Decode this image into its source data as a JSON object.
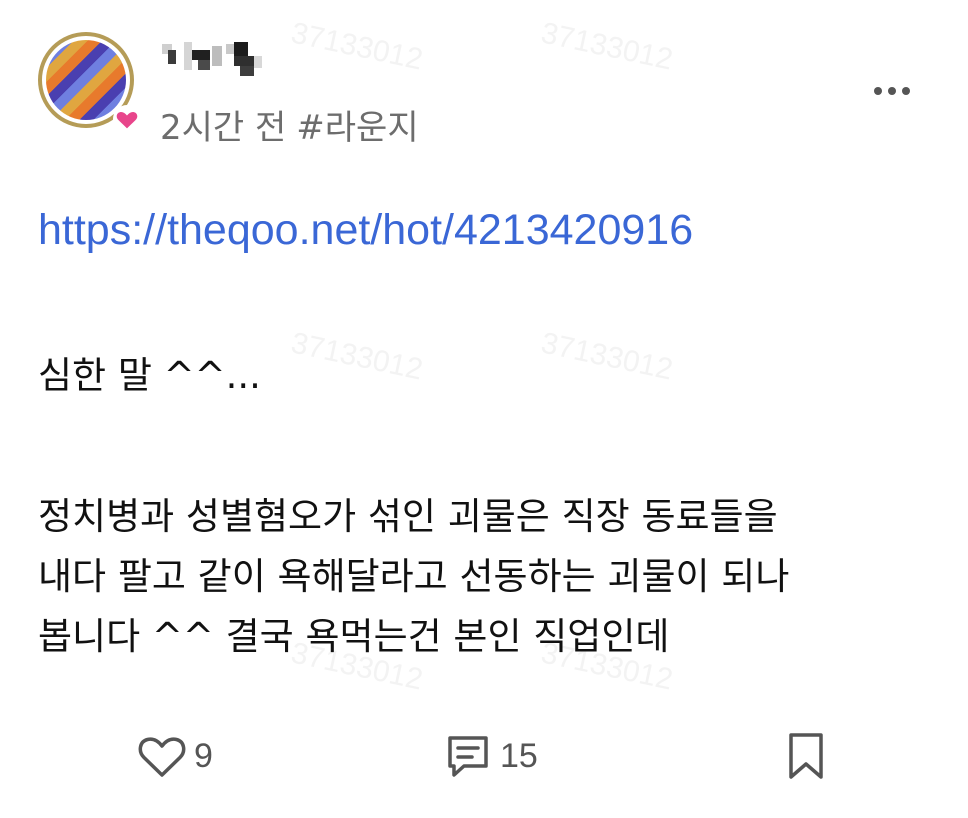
{
  "watermark": "37133012",
  "post": {
    "time": "2시간 전",
    "tag": "#라운지",
    "link": "https://theqoo.net/hot/4213420916",
    "paragraph1": "심한 말 ^^...",
    "paragraph2": "정치병과 성별혐오가 섞인 괴물은 직장 동료들을\n내다 팔고 같이 욕해달라고 선동하는 괴물이 되나\n봅니다 ^^ 결국 욕먹는건 본인 직업인데"
  },
  "actions": {
    "like_count": "9",
    "comment_count": "15"
  },
  "icons": {
    "avatar": "avatar-image",
    "badge": "heart-icon",
    "more": "more-icon",
    "like": "heart-outline-icon",
    "comment": "comment-icon",
    "bookmark": "bookmark-icon"
  },
  "colors": {
    "link": "#3a67d6",
    "meta": "#6d6d6d",
    "heart_badge": "#e8458b",
    "avatar_ring": "#b59c57"
  }
}
